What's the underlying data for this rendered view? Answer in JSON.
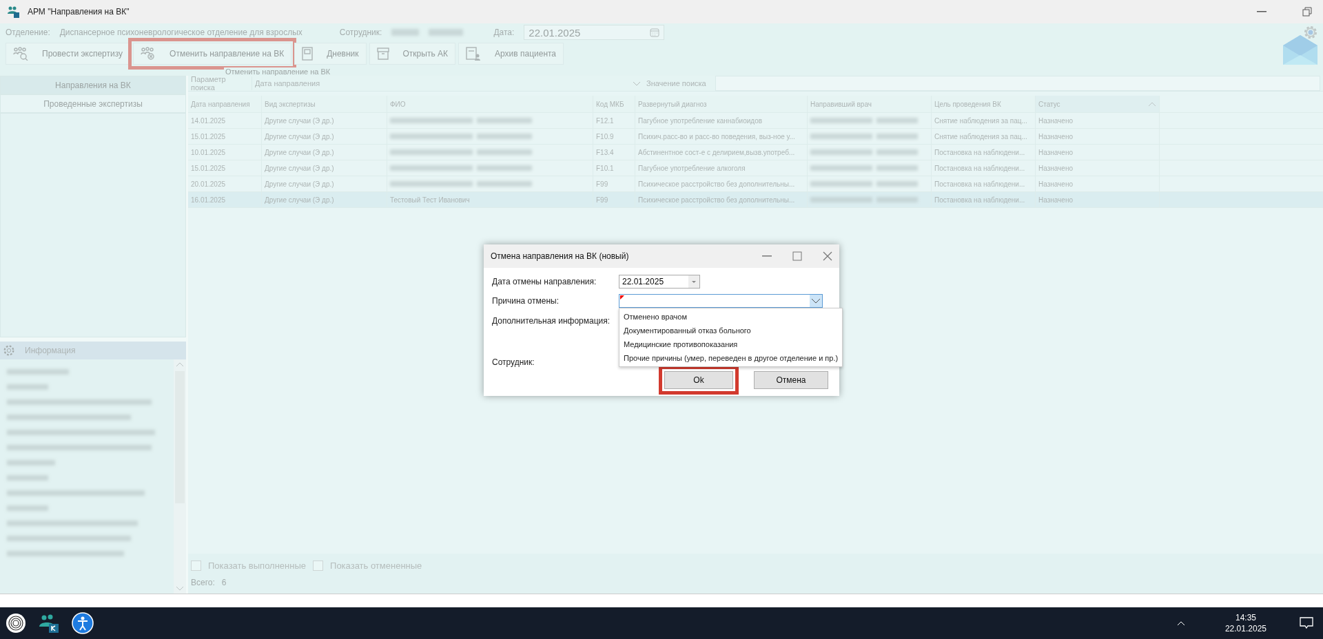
{
  "window": {
    "title": "АРМ \"Направления на ВК\""
  },
  "info_bar": {
    "department_label": "Отделение:",
    "department": "Диспансерное психоневрологическое отделение для взрослых",
    "employee_label": "Сотрудник:",
    "date_label": "Дата:",
    "date": "22.01.2025"
  },
  "toolbar": [
    {
      "label": "Провести экспертизу",
      "kind": "examine",
      "highlighted": false
    },
    {
      "label": "Отменить направление на ВК",
      "kind": "cancel",
      "highlighted": true
    },
    {
      "label": "Дневник",
      "kind": "diary",
      "highlighted": false
    },
    {
      "label": "Открыть АК",
      "kind": "box",
      "highlighted": false
    },
    {
      "label": "Архив пациента",
      "kind": "patient",
      "highlighted": false
    }
  ],
  "tooltip": "Отменить направление на ВК",
  "sidebar": {
    "items": [
      {
        "label": "Направления на ВК",
        "selected": true
      },
      {
        "label": "Проведенные экспертизы",
        "selected": false
      }
    ]
  },
  "info_panel": {
    "title": "Информация"
  },
  "search": {
    "param_label": "Параметр поиска",
    "param_value": "Дата направления",
    "value_label": "Значение поиска"
  },
  "table": {
    "columns": [
      {
        "label": "Дата направления",
        "sorted": false
      },
      {
        "label": "Вид экспертизы",
        "sorted": false
      },
      {
        "label": "ФИО",
        "sorted": false
      },
      {
        "label": "Код МКБ",
        "sorted": false
      },
      {
        "label": "Развернутый диагноз",
        "sorted": false
      },
      {
        "label": "Направивший врач",
        "sorted": false
      },
      {
        "label": "Цель проведения ВК",
        "sorted": false
      },
      {
        "label": "Статус",
        "sorted": true
      }
    ],
    "rows": [
      {
        "date": "14.01.2025",
        "type": "Другие случаи (Э др.)",
        "mkb": "F12.1",
        "diagnosis": "Пагубное употребление каннабиоидов",
        "goal": "Снятие наблюдения за пац...",
        "status": "Назначено",
        "selected": false
      },
      {
        "date": "15.01.2025",
        "type": "Другие случаи (Э др.)",
        "mkb": "F10.9",
        "diagnosis": "Психич.расс-во и расс-во поведения, выз-ное у...",
        "goal": "Снятие наблюдения за пац...",
        "status": "Назначено",
        "selected": false
      },
      {
        "date": "10.01.2025",
        "type": "Другие случаи (Э др.)",
        "mkb": "F13.4",
        "diagnosis": "Абстинентное сост-е с делирием,вызв.употреб...",
        "goal": "Постановка на наблюдени...",
        "status": "Назначено",
        "selected": false
      },
      {
        "date": "15.01.2025",
        "type": "Другие случаи (Э др.)",
        "mkb": "F10.1",
        "diagnosis": "Пагубное употребление алкоголя",
        "goal": "Постановка на наблюдени...",
        "status": "Назначено",
        "selected": false
      },
      {
        "date": "20.01.2025",
        "type": "Другие случаи (Э др.)",
        "mkb": "F99",
        "diagnosis": "Психическое расстройство без дополнительны...",
        "goal": "Постановка на наблюдени...",
        "status": "Назначено",
        "selected": false
      },
      {
        "date": "16.01.2025",
        "type": "Другие случаи (Э др.)",
        "fio": "Тестовый Тест Иванович",
        "mkb": "F99",
        "diagnosis": "Психическое расстройство без дополнительны...",
        "goal": "Постановка на наблюдени...",
        "status": "Назначено",
        "selected": true
      }
    ]
  },
  "footer": {
    "filters": [
      {
        "label": "Показать выполненные",
        "checked": false
      },
      {
        "label": "Показать отмененные",
        "checked": false
      }
    ],
    "total_label": "Всего:",
    "total": "6"
  },
  "dialog": {
    "title": "Отмена направления на ВК (новый)",
    "date_label": "Дата отмены направления:",
    "date": "22.01.2025",
    "reason_label": "Причина отмены:",
    "reason_required": true,
    "reason_expanded": true,
    "reason_options": [
      "Отменено врачом",
      "Документированный отказ больного",
      "Медицинские противопоказания",
      "Прочие причины (умер, переведен в другое отделение и пр.)"
    ],
    "extra_label": "Дополнительная информация:",
    "employee_label": "Сотрудник:",
    "buttons": [
      {
        "label": "Ok",
        "highlighted": true
      },
      {
        "label": "Отмена",
        "highlighted": false
      }
    ]
  },
  "taskbar": {
    "time": "14:35",
    "date": "22.01.2025"
  }
}
